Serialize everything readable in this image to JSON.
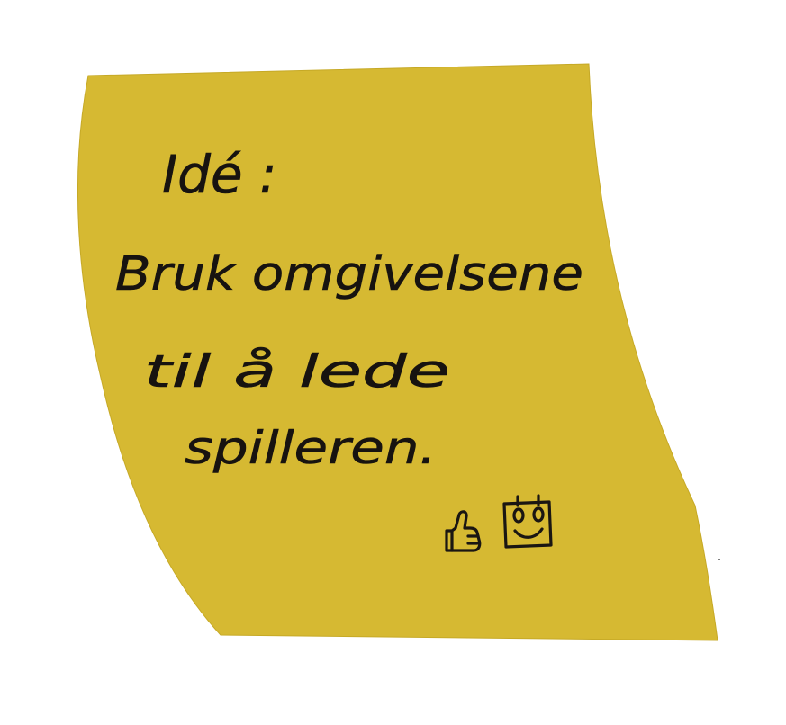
{
  "note": {
    "color": "#d6b932",
    "lines": [
      "Idé :",
      "Bruk omgivelsene",
      "til å lede",
      "spilleren."
    ],
    "doodles": [
      "thumbs-up-icon",
      "smiley-face-icon"
    ]
  }
}
